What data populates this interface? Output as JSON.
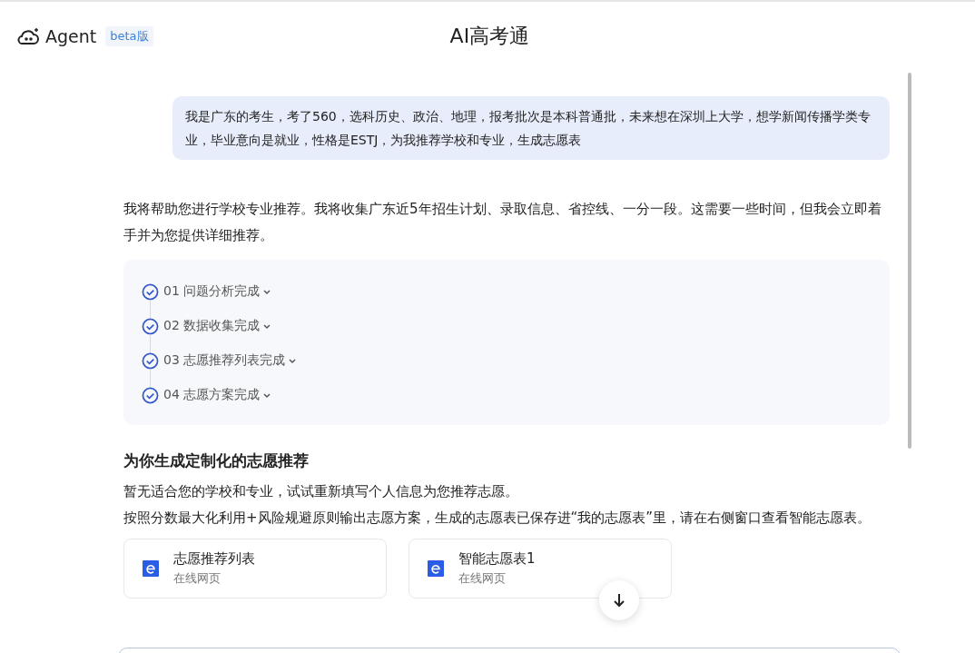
{
  "header": {
    "brand": "Agent",
    "badge": "beta版",
    "title": "AI高考通"
  },
  "user_message": "我是广东的考生，考了560，选科历史、政治、地理，报考批次是本科普通批，未来想在深圳上大学，想学新闻传播学类专业，毕业意向是就业，性格是ESTJ，为我推荐学校和专业，生成志愿表",
  "reply_intro": "我将帮助您进行学校专业推荐。我将收集广东近5年招生计划、录取信息、省控线、一分一段。这需要一些时间，但我会立即着手并为您提供详细推荐。",
  "steps": [
    {
      "label": "01 问题分析完成",
      "done": true,
      "expanded": false
    },
    {
      "label": "02 数据收集完成",
      "done": true,
      "expanded": false
    },
    {
      "label": "03 志愿推荐列表完成",
      "done": true,
      "expanded": false
    },
    {
      "label": "04 志愿方案完成",
      "done": true,
      "expanded": false
    }
  ],
  "section_title": "为你生成定制化的志愿推荐",
  "paragraphs": [
    "暂无适合您的学校和专业，试试重新填写个人信息为您推荐志愿。",
    "按照分数最大化利用+风险规避原则输出志愿方案，生成的志愿表已保存进“我的志愿表”里，请在右侧窗口查看智能志愿表。"
  ],
  "cards": [
    {
      "title": "志愿推荐列表",
      "subtitle": "在线网页"
    },
    {
      "title": "智能志愿表1",
      "subtitle": "在线网页"
    }
  ]
}
